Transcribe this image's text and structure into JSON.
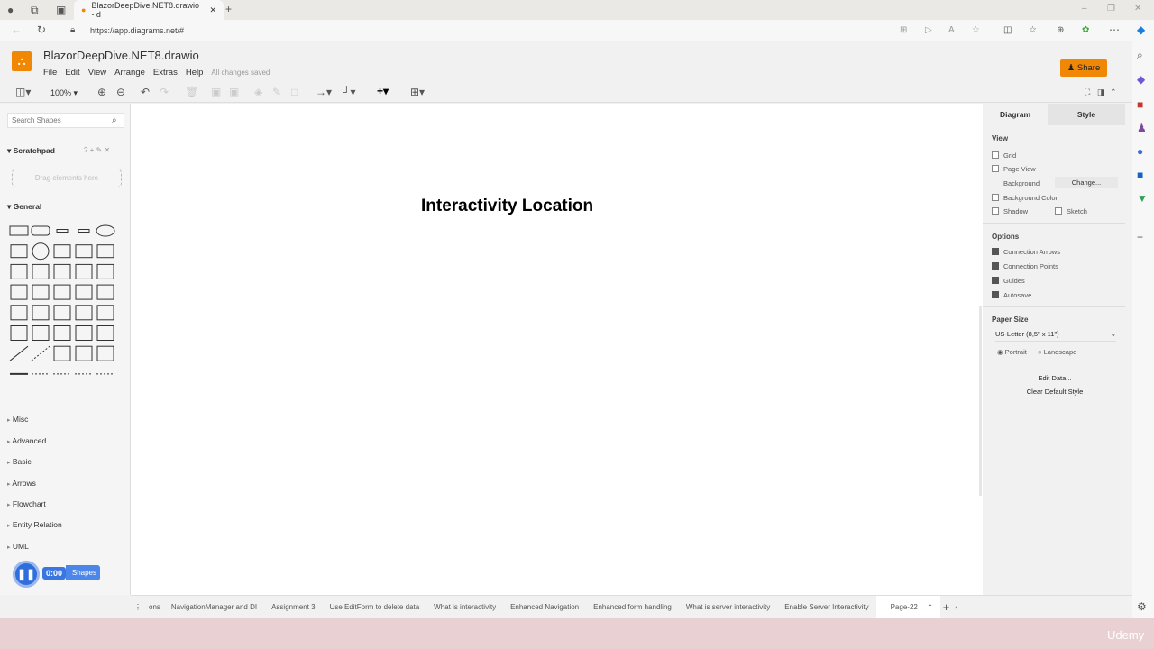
{
  "browser": {
    "tab_title": "BlazorDeepDive.NET8.drawio - d",
    "url": "https://app.diagrams.net/#"
  },
  "app": {
    "file_title": "BlazorDeepDive.NET8.drawio",
    "menu": [
      "File",
      "Edit",
      "View",
      "Arrange",
      "Extras",
      "Help"
    ],
    "save_status": "All changes saved",
    "share_label": "Share",
    "zoom": "100%",
    "accent": "#f08705"
  },
  "sidebar": {
    "search_placeholder": "Search Shapes",
    "scratchpad": "Scratchpad",
    "scratch_actions": "? + ✎ ✕",
    "drag_hint": "Drag elements here",
    "general": "General",
    "sections": [
      "Misc",
      "Advanced",
      "Basic",
      "Arrows",
      "Flowchart",
      "Entity Relation",
      "UML"
    ],
    "more_shapes": "Shapes"
  },
  "canvas": {
    "heading": "Interactivity Location"
  },
  "panel": {
    "tabs": [
      "Diagram",
      "Style"
    ],
    "view_header": "View",
    "grid": "Grid",
    "page_view": "Page View",
    "background": "Background",
    "change": "Change...",
    "background_color": "Background Color",
    "shadow": "Shadow",
    "sketch": "Sketch",
    "options_header": "Options",
    "options": [
      "Connection Arrows",
      "Connection Points",
      "Guides",
      "Autosave"
    ],
    "paper_header": "Paper Size",
    "paper_size": "US-Letter (8,5\" x 11\")",
    "portrait": "Portrait",
    "landscape": "Landscape",
    "edit_data": "Edit Data...",
    "clear_style": "Clear Default Style"
  },
  "pages": {
    "items": [
      "ons",
      "NavigationManager and DI",
      "Assignment 3",
      "Use EditForm to delete data",
      "What is interactivity",
      "Enhanced Navigation",
      "Enhanced form handling",
      "What is server interactivity",
      "Enable Server Interactivity"
    ],
    "current": "Page-22"
  },
  "video": {
    "time": "0:00",
    "watermark": "Udemy"
  }
}
